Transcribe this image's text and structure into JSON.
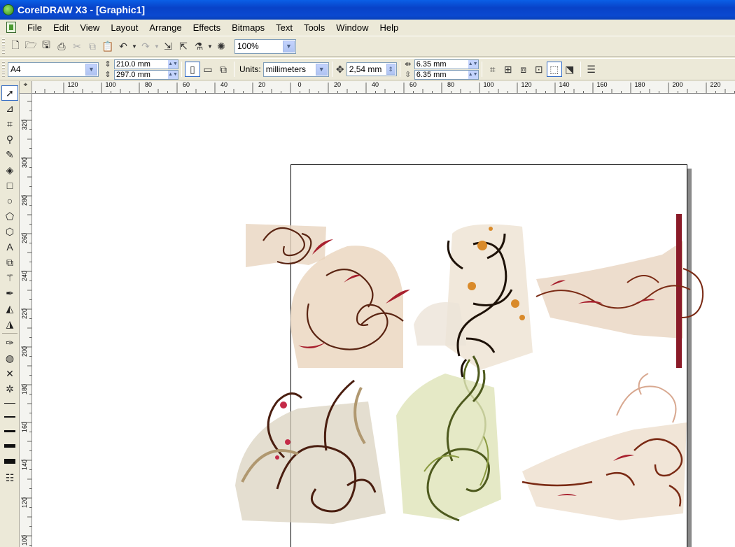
{
  "window": {
    "title": "CorelDRAW X3 - [Graphic1]"
  },
  "menu": [
    "File",
    "Edit",
    "View",
    "Layout",
    "Arrange",
    "Effects",
    "Bitmaps",
    "Text",
    "Tools",
    "Window",
    "Help"
  ],
  "standard_toolbar": {
    "zoom": "100%"
  },
  "property_bar": {
    "paper_size": "A4",
    "width": "210.0 mm",
    "height": "297.0 mm",
    "units_label": "Units:",
    "units_value": "millimeters",
    "nudge": "2,54 mm",
    "dup_x": "6.35 mm",
    "dup_y": "6.35 mm"
  },
  "hruler": {
    "labels": [
      "120",
      "100",
      "80",
      "60",
      "40",
      "20",
      "0",
      "20",
      "40",
      "60",
      "80",
      "100",
      "120",
      "140",
      "160",
      "180",
      "200",
      "220"
    ]
  },
  "vruler": {
    "labels": [
      "320",
      "300",
      "280",
      "260",
      "240",
      "220",
      "200",
      "180",
      "160",
      "140",
      "120",
      "100"
    ]
  },
  "icons": {
    "toolbox": [
      "pick-tool-icon",
      "shape-tool-icon",
      "crop-tool-icon",
      "zoom-tool-icon",
      "freehand-tool-icon",
      "smart-fill-tool-icon",
      "rectangle-tool-icon",
      "ellipse-tool-icon",
      "polygon-tool-icon",
      "basic-shapes-tool-icon",
      "text-tool-icon",
      "interactive-blend-tool-icon",
      "eyedropper-tool-icon",
      "outline-tool-icon",
      "fill-tool-icon",
      "interactive-fill-tool-icon"
    ]
  },
  "colors": {
    "title_blue": "#0a49d0",
    "chrome": "#ece9d8",
    "floral_brown": "#4a1e10",
    "floral_red": "#a81e2e",
    "floral_olive": "#4e5a1e"
  }
}
